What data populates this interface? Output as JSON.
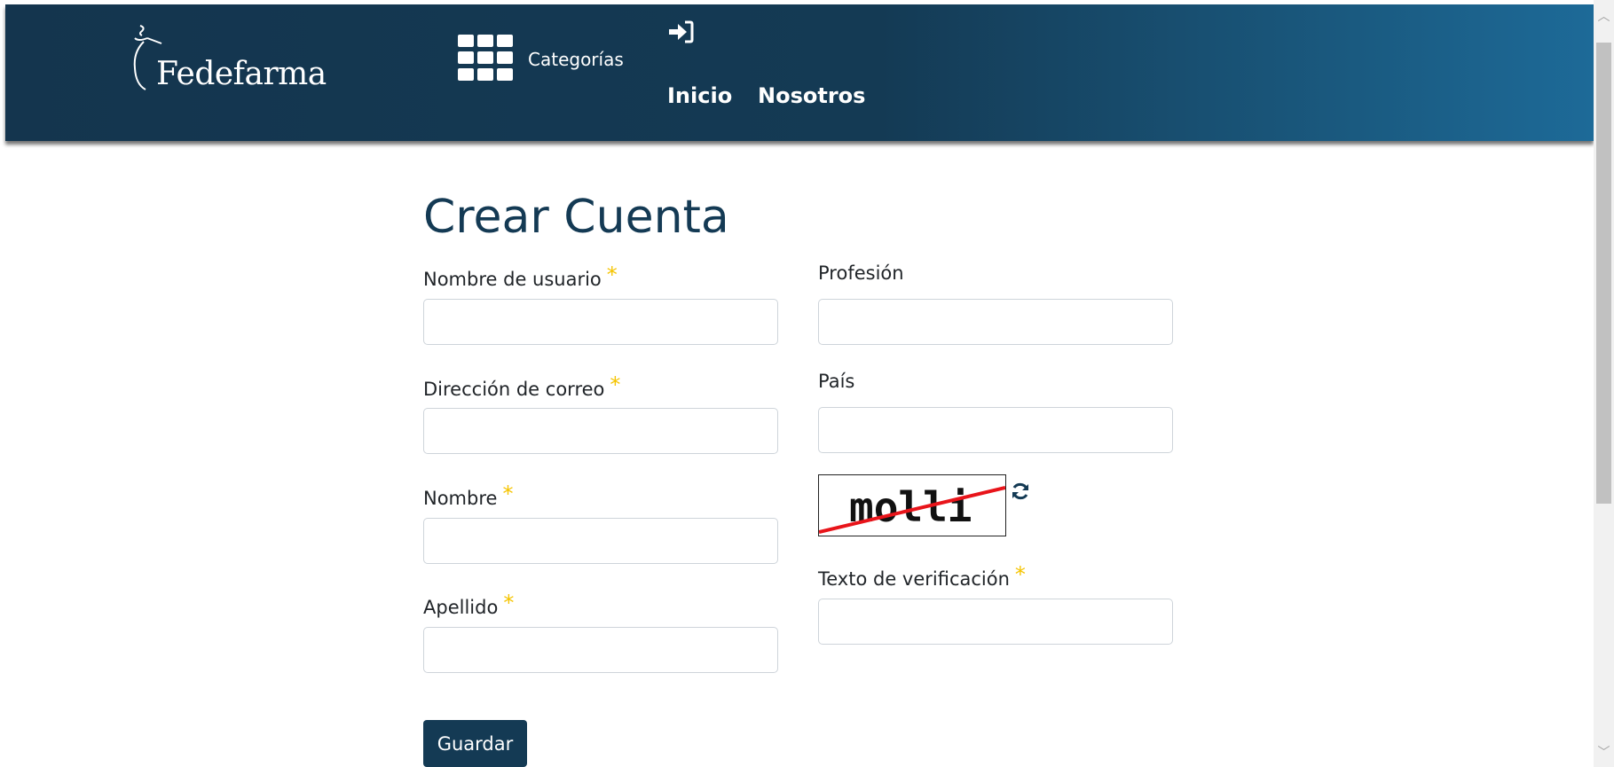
{
  "header": {
    "logo_text": "Fedefarma",
    "categories_label": "Categorías",
    "nav": {
      "inicio": "Inicio",
      "nosotros": "Nosotros"
    }
  },
  "form": {
    "title": "Crear Cuenta",
    "required_mark": "*",
    "fields": {
      "username": {
        "label": "Nombre de usuario",
        "value": ""
      },
      "email": {
        "label": "Dirección de correo",
        "value": ""
      },
      "first_name": {
        "label": "Nombre",
        "value": ""
      },
      "last_name": {
        "label": "Apellido",
        "value": ""
      },
      "profession": {
        "label": "Profesión",
        "value": ""
      },
      "country": {
        "label": "País",
        "value": ""
      },
      "verification": {
        "label": "Texto de verificación",
        "value": ""
      }
    },
    "captcha_text": "molli",
    "save_label": "Guardar"
  },
  "colors": {
    "header_dark": "#14354e",
    "header_light": "#1d6a98",
    "title": "#143a54",
    "required_star": "#f5c400",
    "button": "#143a54"
  },
  "icons": [
    "apps-grid-icon",
    "login-icon",
    "refresh-icon",
    "scroll-up-arrow-icon",
    "scroll-down-arrow-icon"
  ]
}
